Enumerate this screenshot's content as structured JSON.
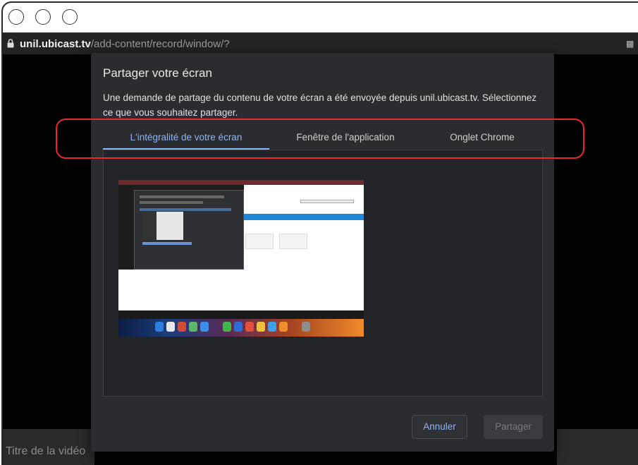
{
  "browser": {
    "url_host": "unil.ubicast.tv",
    "url_path": "/add-content/record/window/?"
  },
  "page": {
    "video_title_placeholder": "Titre de la vidéo"
  },
  "dialog": {
    "title": "Partager votre écran",
    "description": "Une demande de partage du contenu de votre écran a été envoyée depuis unil.ubicast.tv. Sélectionnez ce que vous souhaitez partager.",
    "tabs": [
      {
        "label": "L'intégralité de votre écran",
        "active": true
      },
      {
        "label": "Fenêtre de l'application",
        "active": false
      },
      {
        "label": "Onglet Chrome",
        "active": false
      }
    ],
    "cancel_label": "Annuler",
    "share_label": "Partager"
  },
  "colors": {
    "accent": "#8ab4f8",
    "highlight": "#e82a2a",
    "dialog_bg": "#2b2c2f"
  },
  "icons": [
    "lock-icon",
    "extension-icon"
  ]
}
